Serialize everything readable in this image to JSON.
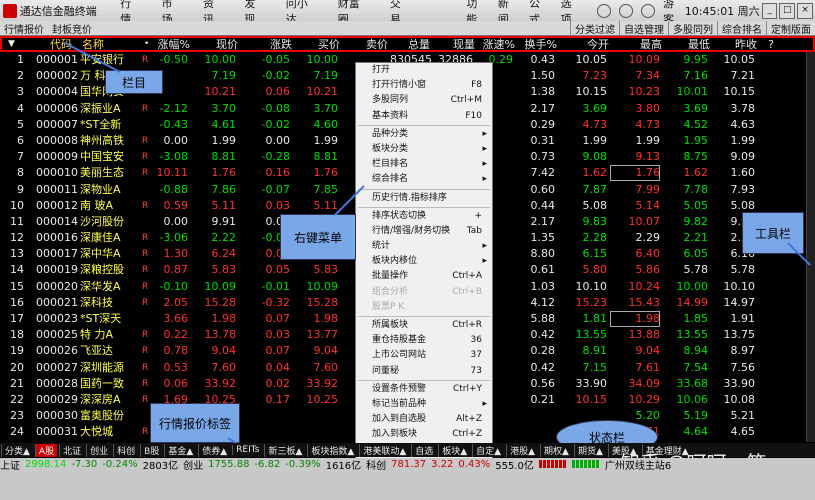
{
  "titlebar": {
    "app_title": "通达信金融终端",
    "menu": [
      "行情",
      "市场",
      "资讯",
      "发现",
      "问小达",
      "财富圈",
      "交易"
    ],
    "right_menu": [
      "功能",
      "新闻",
      "公式",
      "选项"
    ],
    "user": "游客",
    "clock": "10:45:01 周六"
  },
  "toolbar2": {
    "left": [
      "行情报价",
      "封板竞价"
    ],
    "right": [
      "分类过滤",
      "自选管理",
      "多股同列",
      "综合排名",
      "定制版面"
    ]
  },
  "columns": [
    "代码",
    "名称",
    "•",
    "涨幅%",
    "现价",
    "涨跌",
    "买价",
    "卖价",
    "总量",
    "现量",
    "涨速%",
    "换手%",
    "今开",
    "最高",
    "最低",
    "昨收",
    "?"
  ],
  "rows": [
    {
      "i": "1",
      "code": "000001",
      "name": "平安银行",
      "f": "R",
      "pct": "-0.50",
      "price": "10.00",
      "chg": "-0.05",
      "bid": "10.00",
      "ask": "",
      "vol": "830545",
      "cur": "32886",
      "spd": "0.29",
      "turn": "0.43",
      "open": "10.05",
      "high": "10.09",
      "low": "9.95",
      "prev": "10.05",
      "dir": "dn"
    },
    {
      "i": "2",
      "code": "000002",
      "name": "万 科A",
      "f": "R",
      "pct": "",
      "price": "7.19",
      "chg": "-0.02",
      "bid": "7.19",
      "ask": "",
      "vol": "",
      "cur": "",
      "spd": "",
      "turn": "1.50",
      "open": "7.23",
      "high": "7.34",
      "low": "7.16",
      "prev": "7.21",
      "dir": "dn"
    },
    {
      "i": "3",
      "code": "000004",
      "name": "国华网安",
      "f": "",
      "pct": "",
      "price": "10.21",
      "chg": "0.06",
      "bid": "10.21",
      "ask": "",
      "vol": "",
      "cur": "",
      "spd": "",
      "turn": "1.38",
      "open": "10.15",
      "high": "10.23",
      "low": "10.01",
      "prev": "10.15",
      "dir": "up"
    },
    {
      "i": "4",
      "code": "000006",
      "name": "深振业A",
      "f": "R",
      "pct": "-2.12",
      "price": "3.70",
      "chg": "-0.08",
      "bid": "3.70",
      "ask": "",
      "vol": "",
      "cur": "",
      "spd": "",
      "turn": "2.17",
      "open": "3.69",
      "high": "3.80",
      "low": "3.69",
      "prev": "3.78",
      "dir": "dn"
    },
    {
      "i": "5",
      "code": "000007",
      "name": "*ST全新",
      "f": "",
      "pct": "-0.43",
      "price": "4.61",
      "chg": "-0.02",
      "bid": "4.60",
      "ask": "",
      "vol": "",
      "cur": "",
      "spd": "",
      "turn": "0.29",
      "open": "4.73",
      "high": "4.73",
      "low": "4.52",
      "prev": "4.63",
      "dir": "dn"
    },
    {
      "i": "6",
      "code": "000008",
      "name": "神州高铁",
      "f": "R",
      "pct": "0.00",
      "price": "1.99",
      "chg": "0.00",
      "bid": "1.99",
      "ask": "",
      "vol": "",
      "cur": "",
      "spd": "",
      "turn": "0.31",
      "open": "1.99",
      "high": "1.99",
      "low": "1.95",
      "prev": "1.99",
      "dir": "fl"
    },
    {
      "i": "7",
      "code": "000009",
      "name": "中国宝安",
      "f": "R",
      "pct": "-3.08",
      "price": "8.81",
      "chg": "-0.28",
      "bid": "8.81",
      "ask": "",
      "vol": "",
      "cur": "",
      "spd": "",
      "turn": "0.73",
      "open": "9.08",
      "high": "9.13",
      "low": "8.75",
      "prev": "9.09",
      "dir": "dn"
    },
    {
      "i": "8",
      "code": "000010",
      "name": "美丽生态",
      "f": "R",
      "pct": "10.11",
      "price": "1.76",
      "chg": "0.16",
      "bid": "1.76",
      "ask": "",
      "vol": "",
      "cur": "",
      "spd": "",
      "turn": "7.42",
      "open": "1.62",
      "high": "1.76",
      "low": "1.62",
      "prev": "1.60",
      "dir": "up"
    },
    {
      "i": "9",
      "code": "000011",
      "name": "深物业A",
      "f": "",
      "pct": "-0.88",
      "price": "7.86",
      "chg": "-0.07",
      "bid": "7.85",
      "ask": "",
      "vol": "",
      "cur": "",
      "spd": "",
      "turn": "0.60",
      "open": "7.87",
      "high": "7.99",
      "low": "7.78",
      "prev": "7.93",
      "dir": "dn"
    },
    {
      "i": "10",
      "code": "000012",
      "name": "南 玻A",
      "f": "R",
      "pct": "0.59",
      "price": "5.11",
      "chg": "0.03",
      "bid": "5.11",
      "ask": "",
      "vol": "",
      "cur": "",
      "spd": "",
      "turn": "0.44",
      "open": "5.08",
      "high": "5.14",
      "low": "5.05",
      "prev": "5.08",
      "dir": "up"
    },
    {
      "i": "11",
      "code": "000014",
      "name": "沙河股份",
      "f": "",
      "pct": "0.00",
      "price": "9.91",
      "chg": "0.00",
      "bid": "9.91",
      "ask": "",
      "vol": "",
      "cur": "",
      "spd": "",
      "turn": "2.17",
      "open": "9.83",
      "high": "10.07",
      "low": "9.82",
      "prev": "9.91",
      "dir": "fl"
    },
    {
      "i": "12",
      "code": "000016",
      "name": "深康佳A",
      "f": "R",
      "pct": "-3.06",
      "price": "2.22",
      "chg": "-0.07",
      "bid": "2.22",
      "ask": "",
      "vol": "",
      "cur": "",
      "spd": "",
      "turn": "1.35",
      "open": "2.28",
      "high": "2.29",
      "low": "2.21",
      "prev": "2.29",
      "dir": "dn"
    },
    {
      "i": "13",
      "code": "000017",
      "name": "深中华A",
      "f": "R",
      "pct": "1.30",
      "price": "6.24",
      "chg": "0.08",
      "bid": "6.24",
      "ask": "",
      "vol": "",
      "cur": "",
      "spd": "",
      "turn": "8.80",
      "open": "6.15",
      "high": "6.40",
      "low": "6.05",
      "prev": "6.16",
      "dir": "up"
    },
    {
      "i": "14",
      "code": "000019",
      "name": "深粮控股",
      "f": "R",
      "pct": "0.87",
      "price": "5.83",
      "chg": "0.05",
      "bid": "5.83",
      "ask": "",
      "vol": "",
      "cur": "",
      "spd": "",
      "turn": "0.61",
      "open": "5.80",
      "high": "5.86",
      "low": "5.78",
      "prev": "5.78",
      "dir": "up"
    },
    {
      "i": "15",
      "code": "000020",
      "name": "深华发A",
      "f": "R",
      "pct": "-0.10",
      "price": "10.09",
      "chg": "-0.01",
      "bid": "10.09",
      "ask": "",
      "vol": "",
      "cur": "",
      "spd": "",
      "turn": "1.03",
      "open": "10.10",
      "high": "10.24",
      "low": "10.00",
      "prev": "10.10",
      "dir": "dn"
    },
    {
      "i": "16",
      "code": "000021",
      "name": "深科技",
      "f": "R",
      "pct": "2.05",
      "price": "15.28",
      "chg": "-0.32",
      "bid": "15.28",
      "ask": "",
      "vol": "",
      "cur": "",
      "spd": "",
      "turn": "4.12",
      "open": "15.23",
      "high": "15.43",
      "low": "14.99",
      "prev": "14.97",
      "dir": "up"
    },
    {
      "i": "17",
      "code": "000023",
      "name": "*ST深天",
      "f": "",
      "pct": "3.66",
      "price": "1.98",
      "chg": "0.07",
      "bid": "1.98",
      "ask": "",
      "vol": "",
      "cur": "",
      "spd": "",
      "turn": "5.88",
      "open": "1.81",
      "high": "1.98",
      "low": "1.85",
      "prev": "1.91",
      "dir": "up"
    },
    {
      "i": "18",
      "code": "000025",
      "name": "特 力A",
      "f": "R",
      "pct": "0.22",
      "price": "13.78",
      "chg": "0.03",
      "bid": "13.77",
      "ask": "",
      "vol": "",
      "cur": "",
      "spd": "",
      "turn": "0.42",
      "open": "13.55",
      "high": "13.88",
      "low": "13.55",
      "prev": "13.75",
      "dir": "up"
    },
    {
      "i": "19",
      "code": "000026",
      "name": "飞亚达",
      "f": "R",
      "pct": "0.78",
      "price": "9.04",
      "chg": "0.07",
      "bid": "9.04",
      "ask": "",
      "vol": "",
      "cur": "",
      "spd": "",
      "turn": "0.28",
      "open": "8.91",
      "high": "9.04",
      "low": "8.94",
      "prev": "8.97",
      "dir": "up"
    },
    {
      "i": "20",
      "code": "000027",
      "name": "深圳能源",
      "f": "R",
      "pct": "0.53",
      "price": "7.60",
      "chg": "0.04",
      "bid": "7.60",
      "ask": "",
      "vol": "",
      "cur": "",
      "spd": "",
      "turn": "0.42",
      "open": "7.15",
      "high": "7.61",
      "low": "7.54",
      "prev": "7.56",
      "dir": "up"
    },
    {
      "i": "21",
      "code": "000028",
      "name": "国药一致",
      "f": "R",
      "pct": "0.06",
      "price": "33.92",
      "chg": "0.02",
      "bid": "33.92",
      "ask": "",
      "vol": "",
      "cur": "",
      "spd": "",
      "turn": "0.56",
      "open": "33.90",
      "high": "34.09",
      "low": "33.68",
      "prev": "33.90",
      "dir": "up"
    },
    {
      "i": "22",
      "code": "000029",
      "name": "深深房A",
      "f": "R",
      "pct": "1.69",
      "price": "10.25",
      "chg": "0.17",
      "bid": "10.25",
      "ask": "",
      "vol": "",
      "cur": "",
      "spd": "",
      "turn": "0.21",
      "open": "10.15",
      "high": "10.29",
      "low": "10.06",
      "prev": "10.08",
      "dir": "up"
    },
    {
      "i": "23",
      "code": "000030",
      "name": "富奥股份",
      "f": "",
      "pct": "",
      "price": "",
      "chg": "",
      "bid": "",
      "ask": "",
      "vol": "",
      "cur": "",
      "spd": "",
      "turn": "",
      "open": "",
      "high": "5.20",
      "low": "5.19",
      "prev": "5.21",
      "dir": "dn"
    },
    {
      "i": "24",
      "code": "000031",
      "name": "大悦城",
      "f": "R",
      "pct": "",
      "price": "",
      "chg": "",
      "bid": "",
      "ask": "",
      "vol": "",
      "cur": "",
      "spd": "",
      "turn": "",
      "open": "",
      "high": "4.71",
      "low": "4.64",
      "prev": "4.65",
      "dir": "up"
    },
    {
      "i": "25",
      "code": "000032",
      "name": "深桑达A",
      "f": "",
      "pct": "",
      "price": "",
      "chg": "",
      "bid": "",
      "ask": "",
      "vol": "",
      "cur": "",
      "spd": "",
      "turn": "",
      "open": "",
      "high": "10.68",
      "low": "10.17",
      "prev": "10.21",
      "dir": "up"
    }
  ],
  "context_menu": [
    {
      "label": "打开",
      "sc": "",
      "arr": false,
      "dis": false
    },
    {
      "label": "打开行情小窗",
      "sc": "F8",
      "arr": false,
      "dis": false
    },
    {
      "label": "多股同列",
      "sc": "Ctrl+M",
      "arr": false,
      "dis": false
    },
    {
      "label": "基本资料",
      "sc": "F10",
      "arr": false,
      "dis": false
    },
    {
      "sep": true
    },
    {
      "label": "品种分类",
      "sc": "",
      "arr": true,
      "dis": false
    },
    {
      "label": "板块分类",
      "sc": "",
      "arr": true,
      "dis": false
    },
    {
      "label": "栏目排名",
      "sc": "",
      "arr": true,
      "dis": false
    },
    {
      "label": "综合排名",
      "sc": "",
      "arr": true,
      "dis": false
    },
    {
      "sep": true
    },
    {
      "label": "历史行情.指标排序",
      "sc": "",
      "arr": false,
      "dis": false
    },
    {
      "sep": true
    },
    {
      "label": "排序状态切换",
      "sc": "+",
      "arr": false,
      "dis": false
    },
    {
      "label": "行情/增强/财务切换",
      "sc": "Tab",
      "arr": false,
      "dis": false
    },
    {
      "label": "统计",
      "sc": "",
      "arr": true,
      "dis": false
    },
    {
      "label": "板块内移位",
      "sc": "",
      "arr": true,
      "dis": false
    },
    {
      "label": "批量操作",
      "sc": "Ctrl+A",
      "arr": false,
      "dis": false
    },
    {
      "label": "组合分析",
      "sc": "Ctrl+B",
      "arr": false,
      "dis": true
    },
    {
      "label": "股票P K",
      "sc": "",
      "arr": false,
      "dis": true
    },
    {
      "sep": true
    },
    {
      "label": "所属板块",
      "sc": "Ctrl+R",
      "arr": false,
      "dis": false
    },
    {
      "label": "重仓持股基金",
      "sc": "36",
      "arr": false,
      "dis": false
    },
    {
      "label": "上市公司网站",
      "sc": "37",
      "arr": false,
      "dis": false
    },
    {
      "label": "问董秘",
      "sc": "73",
      "arr": false,
      "dis": false
    },
    {
      "sep": true
    },
    {
      "label": "设置条件预警",
      "sc": "Ctrl+Y",
      "arr": false,
      "dis": false
    },
    {
      "label": "标记当前品种",
      "sc": "",
      "arr": true,
      "dis": false
    },
    {
      "label": "加入到自选股",
      "sc": "Alt+Z",
      "arr": false,
      "dis": false
    },
    {
      "label": "加入到板块",
      "sc": "Ctrl+Z",
      "arr": false,
      "dis": false
    },
    {
      "label": "从当前板块中删除",
      "sc": "Del",
      "arr": false,
      "dis": true
    },
    {
      "label": "从板块中删除",
      "sc": "Alt+D",
      "arr": false,
      "dis": false
    }
  ],
  "callouts": {
    "lanmu": "栏目",
    "menu": "右键菜单",
    "toolbar": "工具栏",
    "tabs": "行情报价标签",
    "status": "状态栏"
  },
  "tabs": [
    "分类▲",
    "A股",
    "北证",
    "创业",
    "科创",
    "B股",
    "基金▲",
    "债券▲",
    "REITs",
    "新三板▲",
    "板块指数▲",
    "港美联动▲",
    "自选",
    "板块▲",
    "自定▲",
    "港股▲",
    "期权▲",
    "期货▲",
    "美股▲",
    "基金理财▲"
  ],
  "status": {
    "sh_label": "上证",
    "sh_val": "2998.14",
    "sh_chg": "-7.30",
    "sh_pct": "-0.24%",
    "sh_amt": "2803亿",
    "cy_label": "创业",
    "cy_val": "1755.88",
    "cy_chg": "-6.82",
    "cy_pct": "-0.39%",
    "cy_amt": "1616亿",
    "kc_label": "科创",
    "kc_val": "781.37",
    "kc_chg": "3.22",
    "kc_pct": "0.43%",
    "kc_amt": "555.0亿",
    "server": "广州双线主站6"
  },
  "watermark": "知乎 @呵呵一笑"
}
